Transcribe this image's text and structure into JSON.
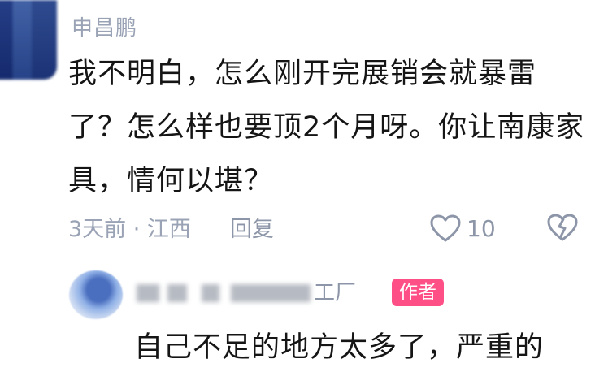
{
  "comment": {
    "author": "申昌鹏",
    "text": "我不明白，怎么刚开完展销会就暴雷了？怎么样也要顶2个月呀。你让南康家具，情何以堪？",
    "time_location": "3天前 · 江西",
    "reply_label": "回复",
    "like_count": "10",
    "icons": {
      "like": "heart-outline-icon",
      "dislike": "broken-heart-icon"
    }
  },
  "reply": {
    "author_visible_tail": "工厂",
    "badge": "作者",
    "text": "自己不足的地方太多了，严重的"
  }
}
